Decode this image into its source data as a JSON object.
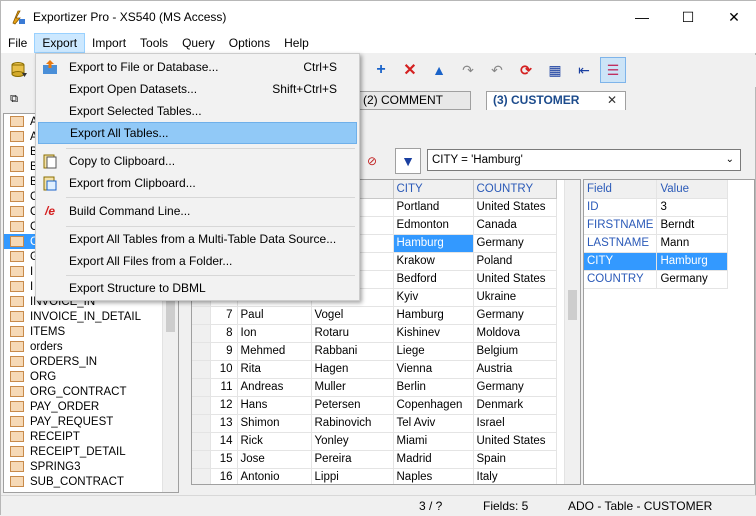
{
  "window": {
    "title": "Exportizer Pro - XS540 (MS Access)",
    "minimize": "—",
    "maximize": "☐",
    "close": "✕"
  },
  "menubar": [
    "File",
    "Export",
    "Import",
    "Tools",
    "Query",
    "Options",
    "Help"
  ],
  "export_menu": {
    "items": [
      {
        "label": "Export to File or Database...",
        "shortcut": "Ctrl+S",
        "icon": "export-file-icon"
      },
      {
        "label": "Export Open Datasets...",
        "shortcut": "Shift+Ctrl+S",
        "icon": ""
      },
      {
        "label": "Export Selected Tables...",
        "shortcut": "",
        "icon": ""
      },
      {
        "label": "Export All Tables...",
        "shortcut": "",
        "icon": "",
        "highlighted": true
      },
      {
        "label": "Copy to Clipboard...",
        "shortcut": "",
        "icon": "copy-clipboard-icon"
      },
      {
        "label": "Export from Clipboard...",
        "shortcut": "",
        "icon": "paste-clipboard-icon"
      },
      {
        "label": "Build Command Line...",
        "shortcut": "",
        "icon": "command-line-icon"
      },
      {
        "label": "Export All Tables from a Multi-Table Data Source...",
        "shortcut": "",
        "icon": ""
      },
      {
        "label": "Export All Files from a Folder...",
        "shortcut": "",
        "icon": ""
      },
      {
        "label": "Export Structure to DBML",
        "shortcut": "",
        "icon": ""
      }
    ]
  },
  "tabs": {
    "comment": "(2) COMMENT",
    "customer": "(3) CUSTOMER",
    "close": "✕"
  },
  "filter": {
    "expression": "CITY = 'Hamburg'"
  },
  "tree": {
    "items": [
      "A",
      "A",
      "B",
      "B",
      "B",
      "C",
      "C",
      "C",
      "C",
      "G",
      "I",
      "I",
      "INVOICE_IN",
      "INVOICE_IN_DETAIL",
      "ITEMS",
      "orders",
      "ORDERS_IN",
      "ORG",
      "ORG_CONTRACT",
      "PAY_ORDER",
      "PAY_REQUEST",
      "RECEIPT",
      "RECEIPT_DETAIL",
      "SPRING3",
      "SUB_CONTRACT"
    ],
    "selected_index": 8
  },
  "grid": {
    "columns": [
      "CITY",
      "COUNTRY"
    ],
    "top_rows": [
      {
        "city": "Portland",
        "country": "United States"
      },
      {
        "city": "Edmonton",
        "country": "Canada"
      },
      {
        "city": "Hamburg",
        "country": "Germany",
        "selected": true
      },
      {
        "city": "Krakow",
        "country": "Poland"
      },
      {
        "city": "Bedford",
        "country": "United States"
      },
      {
        "city": "Kyiv",
        "country": "Ukraine"
      }
    ],
    "rows": [
      {
        "n": "7",
        "first": "Paul",
        "last": "Vogel",
        "city": "Hamburg",
        "country": "Germany"
      },
      {
        "n": "8",
        "first": "Ion",
        "last": "Rotaru",
        "city": "Kishinev",
        "country": "Moldova"
      },
      {
        "n": "9",
        "first": "Mehmed",
        "last": "Rabbani",
        "city": "Liege",
        "country": "Belgium"
      },
      {
        "n": "10",
        "first": "Rita",
        "last": "Hagen",
        "city": "Vienna",
        "country": "Austria"
      },
      {
        "n": "11",
        "first": "Andreas",
        "last": "Muller",
        "city": "Berlin",
        "country": "Germany"
      },
      {
        "n": "12",
        "first": "Hans",
        "last": "Petersen",
        "city": "Copenhagen",
        "country": "Denmark"
      },
      {
        "n": "13",
        "first": "Shimon",
        "last": "Rabinovich",
        "city": "Tel Aviv",
        "country": "Israel"
      },
      {
        "n": "14",
        "first": "Rick",
        "last": "Yonley",
        "city": "Miami",
        "country": "United States"
      },
      {
        "n": "15",
        "first": "Jose",
        "last": "Pereira",
        "city": "Madrid",
        "country": "Spain"
      },
      {
        "n": "16",
        "first": "Antonio",
        "last": "Lippi",
        "city": "Naples",
        "country": "Italy"
      }
    ]
  },
  "record": {
    "headers": [
      "Field",
      "Value"
    ],
    "rows": [
      {
        "field": "ID",
        "value": "3"
      },
      {
        "field": "FIRSTNAME",
        "value": "Berndt"
      },
      {
        "field": "LASTNAME",
        "value": "Mann"
      },
      {
        "field": "CITY",
        "value": "Hamburg",
        "selected": true
      },
      {
        "field": "COUNTRY",
        "value": "Germany"
      }
    ]
  },
  "status": {
    "position": "3 / ?",
    "fields": "Fields: 5",
    "source": "ADO - Table - CUSTOMER"
  },
  "colors": {
    "selection": "#3399ff",
    "menu_highlight": "#91c9f7",
    "header_text": "#2b5ab8"
  }
}
